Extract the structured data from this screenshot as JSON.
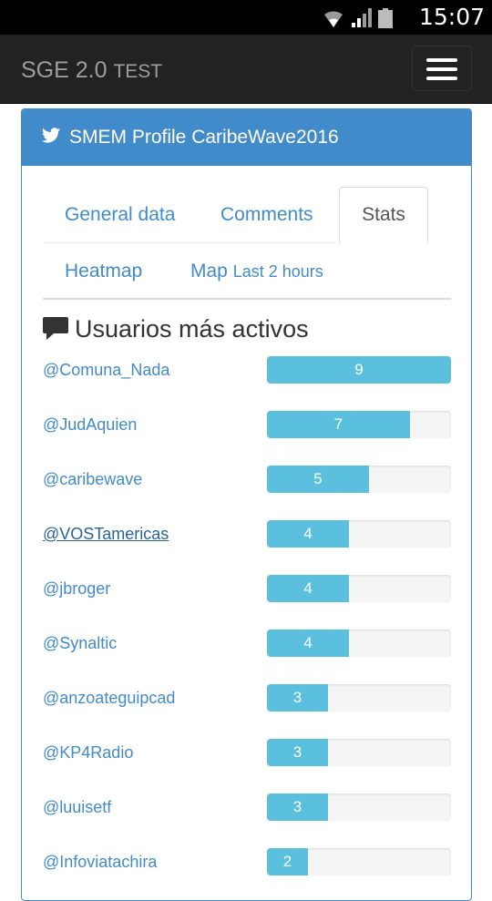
{
  "status_bar": {
    "time": "15:07",
    "icons": [
      "wifi-icon",
      "signal-icon",
      "battery-icon"
    ]
  },
  "navbar": {
    "brand": "SGE 2.0",
    "brand_suffix": "TEST",
    "menu_icon": "hamburger-menu-icon"
  },
  "panel": {
    "icon": "twitter-icon",
    "title": "SMEM Profile CaribeWave2016"
  },
  "tabs": [
    {
      "label": "General data",
      "active": false
    },
    {
      "label": "Comments",
      "active": false
    },
    {
      "label": "Stats",
      "active": true
    },
    {
      "label": "Heatmap",
      "active": false
    },
    {
      "label": "Map",
      "suffix": "Last 2 hours",
      "active": false
    }
  ],
  "section": {
    "icon": "comment-icon",
    "title": "Usuarios más activos"
  },
  "colors": {
    "navbar": "#222222",
    "panel_heading": "#428bca",
    "link": "#428bca",
    "progress": "#5bc0de"
  },
  "active_users": {
    "max": 9,
    "rows": [
      {
        "user": "@Comuna_Nada",
        "count": 9
      },
      {
        "user": "@JudAquien",
        "count": 7
      },
      {
        "user": "@caribewave",
        "count": 5
      },
      {
        "user": "@VOSTamericas",
        "count": 4
      },
      {
        "user": "@jbroger",
        "count": 4
      },
      {
        "user": "@Synaltic",
        "count": 4
      },
      {
        "user": "@anzoateguipcad",
        "count": 3
      },
      {
        "user": "@KP4Radio",
        "count": 3
      },
      {
        "user": "@luuisetf",
        "count": 3
      },
      {
        "user": "@Infoviatachira",
        "count": 2
      }
    ]
  }
}
